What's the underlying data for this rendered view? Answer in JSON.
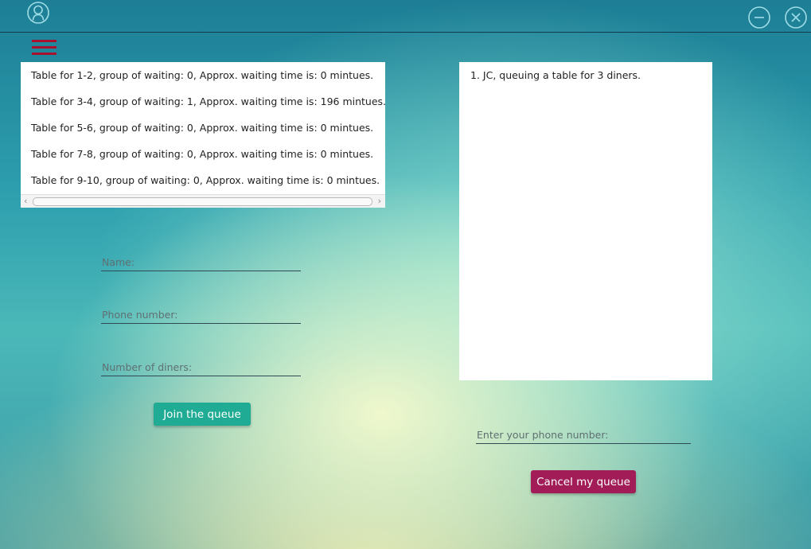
{
  "header": {
    "icons": {
      "user": "user-circle-icon",
      "minimize": "minimize-circle-icon",
      "close": "close-circle-icon",
      "menu": "hamburger-menu-icon"
    },
    "colors": {
      "menu": "#a8122f",
      "outline_icons": "#9fdde6"
    }
  },
  "tables": {
    "items": [
      "Table for 1-2, group of waiting: 0, Approx. waiting time is: 0 mintues.",
      "Table for 3-4, group of waiting: 1, Approx. waiting time is: 196 mintues.",
      "Table for 5-6, group of waiting: 0, Approx. waiting time is: 0 mintues.",
      "Table for 7-8, group of waiting: 0, Approx. waiting time is: 0 mintues.",
      "Table for 9-10, group of waiting: 0, Approx. waiting time is: 0 mintues."
    ],
    "scroll_left": "‹",
    "scroll_right": "›"
  },
  "queue": {
    "items": [
      "1. JC, queuing a table for 3 diners."
    ]
  },
  "join_form": {
    "name_placeholder": "Name:",
    "phone_placeholder": "Phone number:",
    "diners_placeholder": "Number of diners:",
    "submit_label": "Join the queue",
    "submit_color": "#1fab94"
  },
  "cancel_form": {
    "phone_placeholder": "Enter your phone number:",
    "submit_label": "Cancel my queue",
    "submit_color": "#a21d58"
  }
}
